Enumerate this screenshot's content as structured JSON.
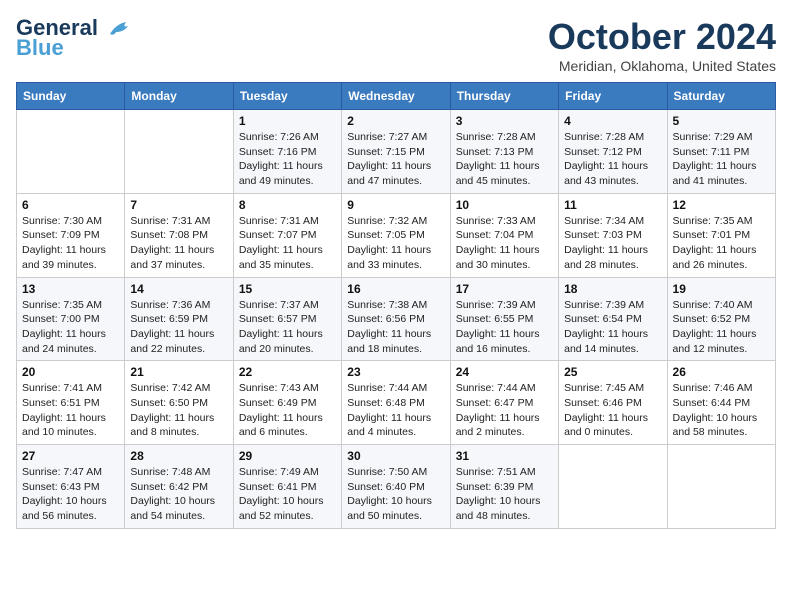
{
  "header": {
    "logo_line1": "General",
    "logo_line2": "Blue",
    "month_title": "October 2024",
    "location": "Meridian, Oklahoma, United States"
  },
  "weekdays": [
    "Sunday",
    "Monday",
    "Tuesday",
    "Wednesday",
    "Thursday",
    "Friday",
    "Saturday"
  ],
  "weeks": [
    [
      {
        "day": "",
        "detail": ""
      },
      {
        "day": "",
        "detail": ""
      },
      {
        "day": "1",
        "detail": "Sunrise: 7:26 AM\nSunset: 7:16 PM\nDaylight: 11 hours and 49 minutes."
      },
      {
        "day": "2",
        "detail": "Sunrise: 7:27 AM\nSunset: 7:15 PM\nDaylight: 11 hours and 47 minutes."
      },
      {
        "day": "3",
        "detail": "Sunrise: 7:28 AM\nSunset: 7:13 PM\nDaylight: 11 hours and 45 minutes."
      },
      {
        "day": "4",
        "detail": "Sunrise: 7:28 AM\nSunset: 7:12 PM\nDaylight: 11 hours and 43 minutes."
      },
      {
        "day": "5",
        "detail": "Sunrise: 7:29 AM\nSunset: 7:11 PM\nDaylight: 11 hours and 41 minutes."
      }
    ],
    [
      {
        "day": "6",
        "detail": "Sunrise: 7:30 AM\nSunset: 7:09 PM\nDaylight: 11 hours and 39 minutes."
      },
      {
        "day": "7",
        "detail": "Sunrise: 7:31 AM\nSunset: 7:08 PM\nDaylight: 11 hours and 37 minutes."
      },
      {
        "day": "8",
        "detail": "Sunrise: 7:31 AM\nSunset: 7:07 PM\nDaylight: 11 hours and 35 minutes."
      },
      {
        "day": "9",
        "detail": "Sunrise: 7:32 AM\nSunset: 7:05 PM\nDaylight: 11 hours and 33 minutes."
      },
      {
        "day": "10",
        "detail": "Sunrise: 7:33 AM\nSunset: 7:04 PM\nDaylight: 11 hours and 30 minutes."
      },
      {
        "day": "11",
        "detail": "Sunrise: 7:34 AM\nSunset: 7:03 PM\nDaylight: 11 hours and 28 minutes."
      },
      {
        "day": "12",
        "detail": "Sunrise: 7:35 AM\nSunset: 7:01 PM\nDaylight: 11 hours and 26 minutes."
      }
    ],
    [
      {
        "day": "13",
        "detail": "Sunrise: 7:35 AM\nSunset: 7:00 PM\nDaylight: 11 hours and 24 minutes."
      },
      {
        "day": "14",
        "detail": "Sunrise: 7:36 AM\nSunset: 6:59 PM\nDaylight: 11 hours and 22 minutes."
      },
      {
        "day": "15",
        "detail": "Sunrise: 7:37 AM\nSunset: 6:57 PM\nDaylight: 11 hours and 20 minutes."
      },
      {
        "day": "16",
        "detail": "Sunrise: 7:38 AM\nSunset: 6:56 PM\nDaylight: 11 hours and 18 minutes."
      },
      {
        "day": "17",
        "detail": "Sunrise: 7:39 AM\nSunset: 6:55 PM\nDaylight: 11 hours and 16 minutes."
      },
      {
        "day": "18",
        "detail": "Sunrise: 7:39 AM\nSunset: 6:54 PM\nDaylight: 11 hours and 14 minutes."
      },
      {
        "day": "19",
        "detail": "Sunrise: 7:40 AM\nSunset: 6:52 PM\nDaylight: 11 hours and 12 minutes."
      }
    ],
    [
      {
        "day": "20",
        "detail": "Sunrise: 7:41 AM\nSunset: 6:51 PM\nDaylight: 11 hours and 10 minutes."
      },
      {
        "day": "21",
        "detail": "Sunrise: 7:42 AM\nSunset: 6:50 PM\nDaylight: 11 hours and 8 minutes."
      },
      {
        "day": "22",
        "detail": "Sunrise: 7:43 AM\nSunset: 6:49 PM\nDaylight: 11 hours and 6 minutes."
      },
      {
        "day": "23",
        "detail": "Sunrise: 7:44 AM\nSunset: 6:48 PM\nDaylight: 11 hours and 4 minutes."
      },
      {
        "day": "24",
        "detail": "Sunrise: 7:44 AM\nSunset: 6:47 PM\nDaylight: 11 hours and 2 minutes."
      },
      {
        "day": "25",
        "detail": "Sunrise: 7:45 AM\nSunset: 6:46 PM\nDaylight: 11 hours and 0 minutes."
      },
      {
        "day": "26",
        "detail": "Sunrise: 7:46 AM\nSunset: 6:44 PM\nDaylight: 10 hours and 58 minutes."
      }
    ],
    [
      {
        "day": "27",
        "detail": "Sunrise: 7:47 AM\nSunset: 6:43 PM\nDaylight: 10 hours and 56 minutes."
      },
      {
        "day": "28",
        "detail": "Sunrise: 7:48 AM\nSunset: 6:42 PM\nDaylight: 10 hours and 54 minutes."
      },
      {
        "day": "29",
        "detail": "Sunrise: 7:49 AM\nSunset: 6:41 PM\nDaylight: 10 hours and 52 minutes."
      },
      {
        "day": "30",
        "detail": "Sunrise: 7:50 AM\nSunset: 6:40 PM\nDaylight: 10 hours and 50 minutes."
      },
      {
        "day": "31",
        "detail": "Sunrise: 7:51 AM\nSunset: 6:39 PM\nDaylight: 10 hours and 48 minutes."
      },
      {
        "day": "",
        "detail": ""
      },
      {
        "day": "",
        "detail": ""
      }
    ]
  ]
}
